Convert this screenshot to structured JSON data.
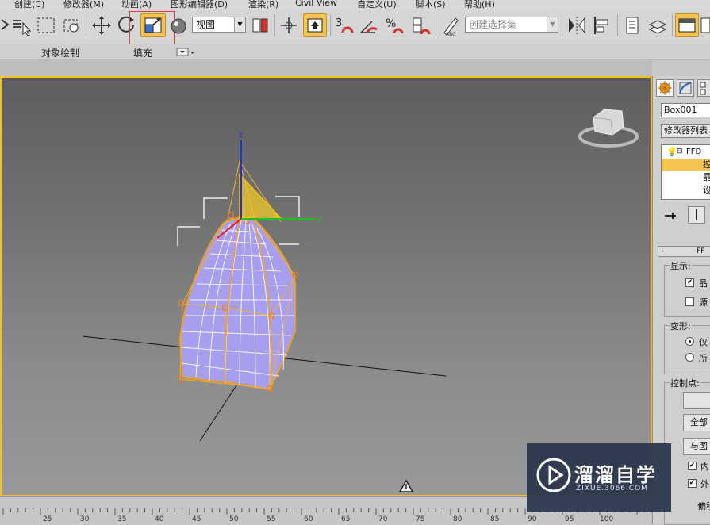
{
  "menubar": {
    "items": [
      "创建(C)",
      "修改器(M)",
      "动画(A)",
      "图形编辑器(D)",
      "渲染(R)",
      "Civil View",
      "自定义(U)",
      "脚本(S)",
      "帮助(H)"
    ]
  },
  "toolbar": {
    "view_dropdown": "视图",
    "selection_set_placeholder": "创建选择集",
    "active_tool": "select-and-scale"
  },
  "ribbon": {
    "labels": [
      "对象绘制",
      "填充"
    ]
  },
  "viewport": {
    "axis_labels": {
      "z": "z",
      "y": "y"
    },
    "mesh_color": "#9a8ee6",
    "lattice_color": "#f0a020"
  },
  "timeslider": {
    "tick_labels": [
      "25",
      "30",
      "35",
      "40",
      "45",
      "50",
      "55",
      "60",
      "65",
      "70",
      "75",
      "80",
      "85",
      "90",
      "95",
      "100"
    ]
  },
  "command_panel": {
    "object_name": "Box001",
    "modifier_list": "修改器列表",
    "stack": [
      "FFD",
      "控",
      "晶",
      "设"
    ],
    "rollout_title": "FF",
    "display_label": "显示:",
    "display_options": [
      {
        "label": "晶",
        "checked": true
      },
      {
        "label": "源",
        "checked": false
      }
    ],
    "deform_label": "变形:",
    "deform_options": [
      {
        "label": "仅",
        "selected": true
      },
      {
        "label": "所",
        "selected": false
      }
    ],
    "control_points_label": "控制点:",
    "buttons": [
      "",
      "全部",
      "与图"
    ],
    "bottom_options": [
      {
        "label": "内",
        "checked": true
      },
      {
        "label": "外",
        "checked": true
      }
    ],
    "offset_label": "偏移"
  },
  "watermark": {
    "title": "溜溜自学",
    "url": "ZIXUE.3066.COM"
  },
  "colors": {
    "accent": "#f3c451",
    "viewport_border": "#f0c420",
    "highlight_box": "#e23a3a"
  }
}
